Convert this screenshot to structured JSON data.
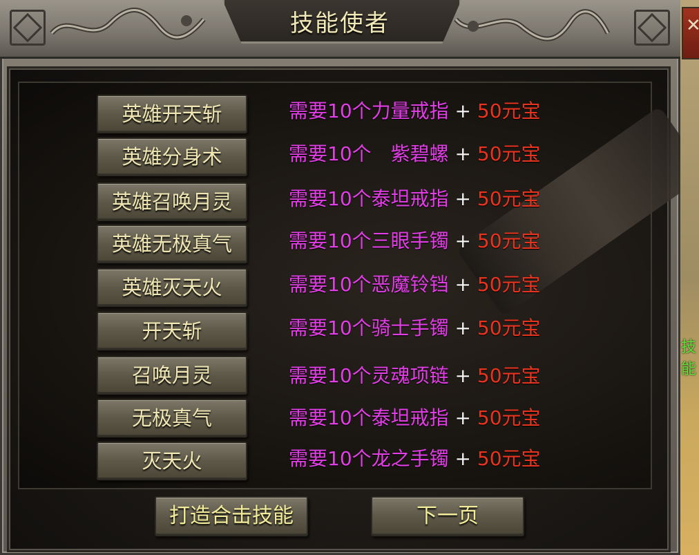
{
  "window": {
    "title": "技能使者"
  },
  "skills": [
    {
      "button": "英雄开天斩",
      "need": "需要10个力量戒指",
      "plus": "+",
      "cost": "50元宝"
    },
    {
      "button": "英雄分身术",
      "need": "需要10个　紫碧螺",
      "plus": "+",
      "cost": "50元宝"
    },
    {
      "button": "英雄召唤月灵",
      "need": "需要10个泰坦戒指",
      "plus": "+",
      "cost": "50元宝"
    },
    {
      "button": "英雄无极真气",
      "need": "需要10个三眼手镯",
      "plus": "+",
      "cost": "50元宝"
    },
    {
      "button": "英雄灭天火",
      "need": "需要10个恶魔铃铛",
      "plus": "+",
      "cost": "50元宝"
    },
    {
      "button": "开天斩",
      "need": "需要10个骑士手镯",
      "plus": "+",
      "cost": "50元宝"
    },
    {
      "button": "召唤月灵",
      "need": "需要10个灵魂项链",
      "plus": "+",
      "cost": "50元宝"
    },
    {
      "button": "无极真气",
      "need": "需要10个泰坦戒指",
      "plus": "+",
      "cost": "50元宝"
    },
    {
      "button": "灭天火",
      "need": "需要10个龙之手镯",
      "plus": "+",
      "cost": "50元宝"
    }
  ],
  "actions": {
    "forge_label": "打造合击技能",
    "next_label": "下一页"
  },
  "side": {
    "partial_text": "技能"
  },
  "colors": {
    "requirement": "#e23ee6",
    "cost": "#e8341f",
    "button_text": "#efe6b4"
  }
}
